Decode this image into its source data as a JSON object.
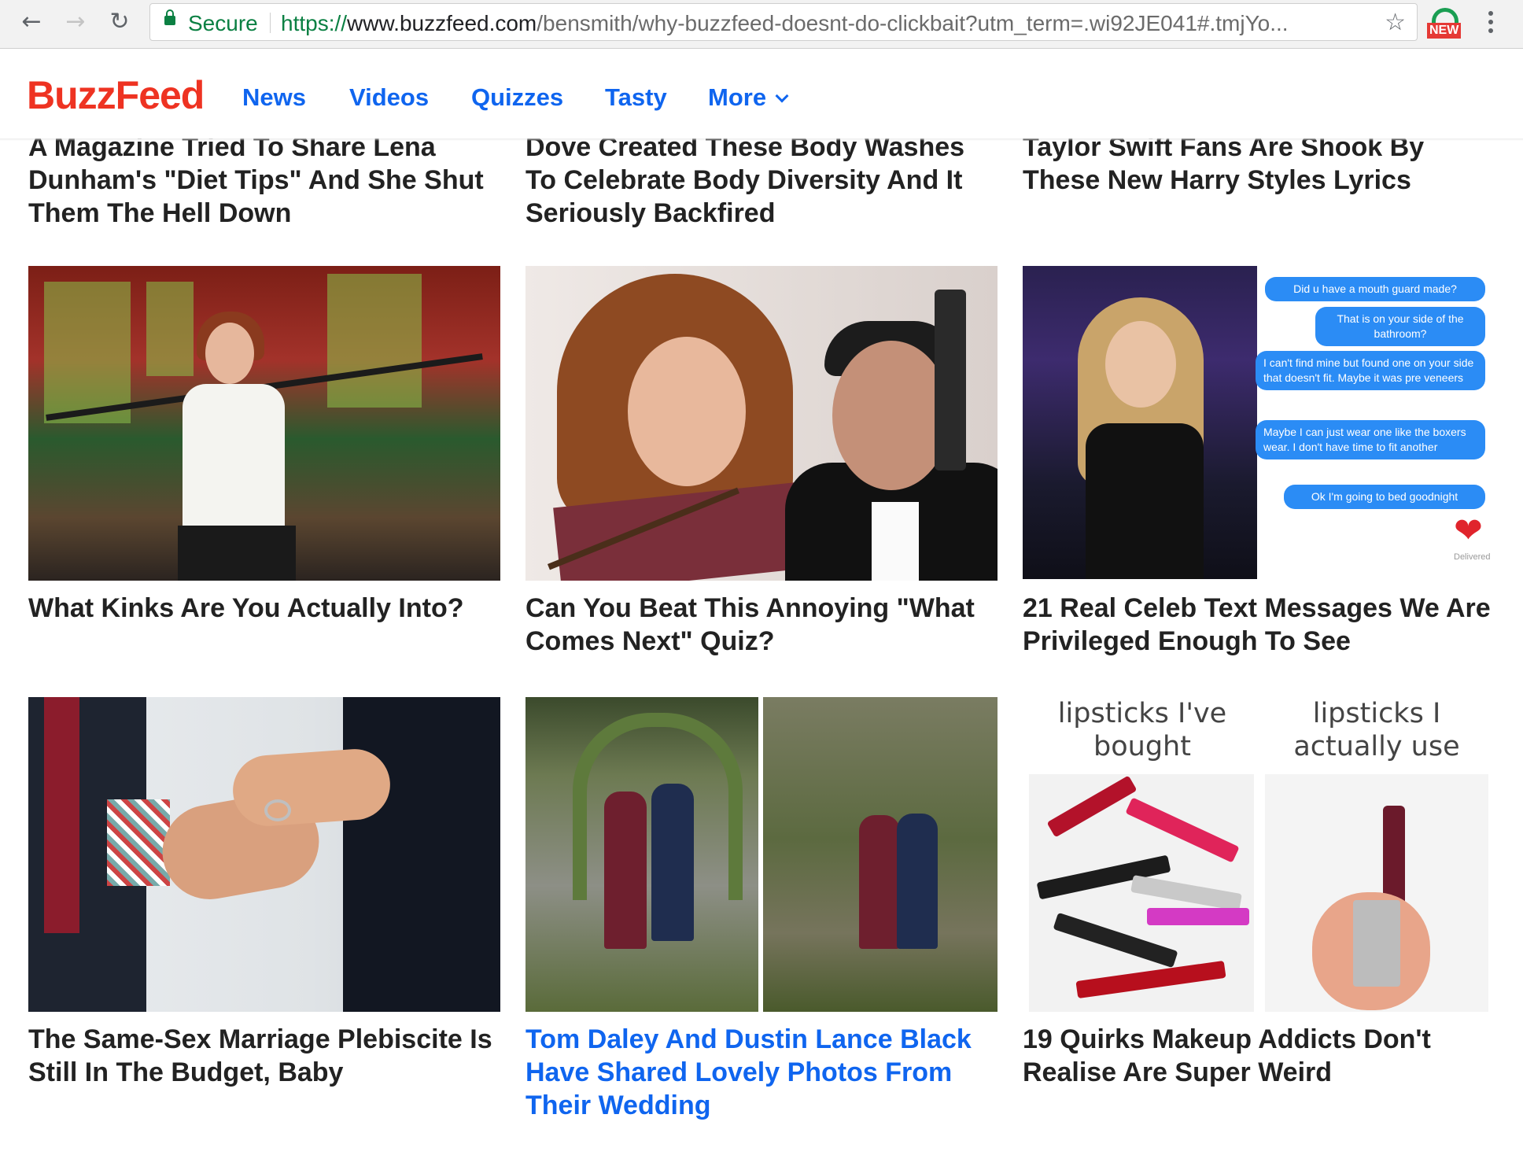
{
  "browser": {
    "back_icon": "arrow-left-icon",
    "forward_icon": "arrow-right-icon",
    "reload_icon": "reload-icon",
    "secure_label": "Secure",
    "url_scheme": "https://",
    "url_host": "www.buzzfeed.com",
    "url_path": "/bensmith/why-buzzfeed-doesnt-do-clickbait?utm_term=.wi92JE041#.tmjYo...",
    "bookmark_icon": "star-icon",
    "extension_badge": "NEW",
    "menu_icon": "kebab-menu-icon"
  },
  "site": {
    "logo": "BuzzFeed",
    "brand_color": "#ee3322",
    "link_color": "#0f65ef",
    "nav": [
      "News",
      "Videos",
      "Quizzes",
      "Tasty",
      "More"
    ]
  },
  "cards": {
    "top": [
      {
        "title": "A Magazine Tried To Share Lena Dunham's \"Diet Tips\" And She Shut Them The Hell Down"
      },
      {
        "title": "Dove Created These Body Washes To Celebrate Body Diversity And It Seriously Backfired"
      },
      {
        "title": "Taylor Swift Fans Are Shook By These New Harry Styles Lyrics"
      }
    ],
    "row1": [
      {
        "title": "What Kinks Are You Actually Into?"
      },
      {
        "title": "Can You Beat This Annoying \"What Comes Next\" Quiz?"
      },
      {
        "title": "21 Real Celeb Text Messages We Are Privileged Enough To See"
      }
    ],
    "row2": [
      {
        "title": "The Same-Sex Marriage Plebiscite Is Still In The Budget, Baby"
      },
      {
        "title": "Tom Daley And Dustin Lance Black Have Shared Lovely Photos From Their Wedding"
      },
      {
        "title": "19 Quirks Makeup Addicts Don't Realise Are Super Weird"
      }
    ]
  },
  "texts_image": {
    "bubbles": [
      "Did u have a mouth guard made?",
      "That is on your side of the bathroom?",
      "I can't find mine but found one on your side that doesn't fit. Maybe it was pre veneers",
      "Maybe I can just wear one like the boxers wear. I don't have time to fit another",
      "Ok I'm going to bed goodnight"
    ],
    "delivered": "Delivered"
  },
  "lipstick_image": {
    "label_left": "lipsticks I've bought",
    "label_right": "lipsticks I actually use"
  }
}
